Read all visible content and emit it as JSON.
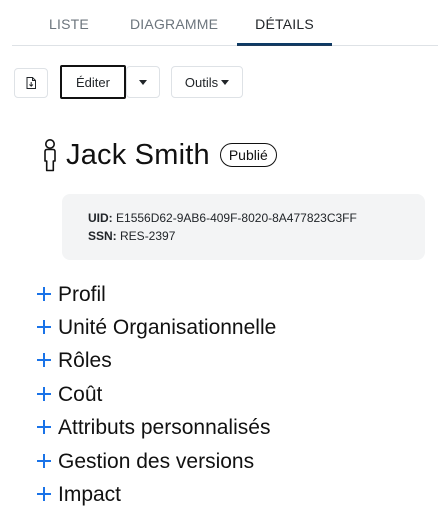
{
  "tabs": [
    {
      "label": "LISTE"
    },
    {
      "label": "DIAGRAMME"
    },
    {
      "label": "DÉTAILS",
      "active": true
    }
  ],
  "toolbar": {
    "file_icon": "file-export-icon",
    "edit_label": "Éditer",
    "tools_label": "Outils"
  },
  "person": {
    "icon": "person-icon",
    "name": "Jack Smith",
    "status": "Publié"
  },
  "identifiers": {
    "uid_key": "UID:",
    "uid_value": "E1556D62-9AB6-409F-8020-8A477823C3FF",
    "ssn_key": "SSN:",
    "ssn_value": "RES-2397"
  },
  "sections": [
    {
      "label": "Profil"
    },
    {
      "label": "Unité Organisationnelle"
    },
    {
      "label": "Rôles"
    },
    {
      "label": "Coût"
    },
    {
      "label": "Attributs personnalisés"
    },
    {
      "label": "Gestion des versions"
    },
    {
      "label": "Impact"
    }
  ],
  "colors": {
    "accent": "#1a73e8",
    "active_tab": "#1f3b5a",
    "id_box": "#f3f4f5"
  }
}
